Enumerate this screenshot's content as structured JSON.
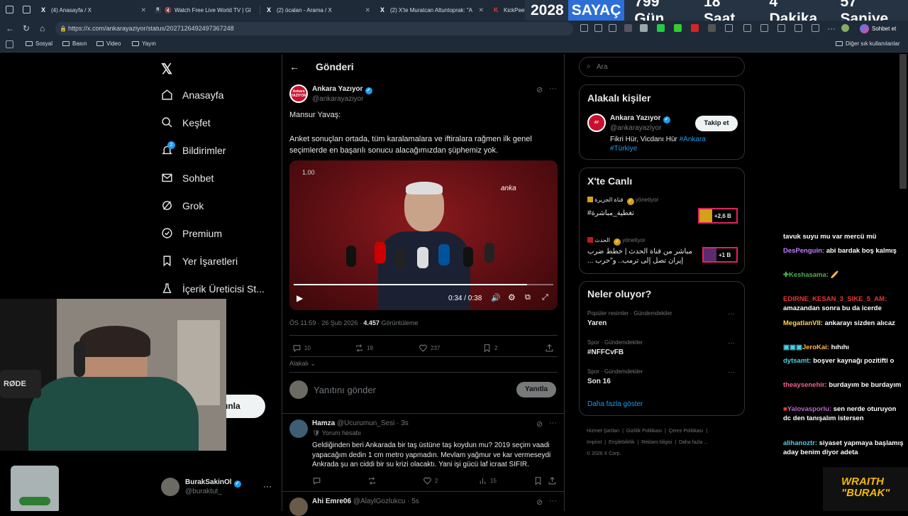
{
  "browser": {
    "tabs": [
      {
        "title": "(4) Anasayfa / X",
        "icon": "X"
      },
      {
        "title": "Watch Free Live World TV | Gl",
        "icon": "fl"
      },
      {
        "title": "(2) öcalan - Arama / X",
        "icon": "X"
      },
      {
        "title": "(2) X'te Muratcan Altuntoprak: \"A",
        "icon": "X"
      },
      {
        "title": "KickPeek",
        "icon": "K"
      }
    ],
    "url": "https://x.com/ankarayaziyor/status/2027126492497367248",
    "chat_button": "Sohbet et",
    "bookmarks": [
      "Sosyal",
      "Basın",
      "Video",
      "Yayın"
    ],
    "bookmarks_other": "Diğer sık kullanılanlar"
  },
  "counter": {
    "year": "2028",
    "label": "SAYAÇ",
    "days": "799 Gün",
    "hours": "18 Saat",
    "minutes": "4 Dakika",
    "seconds": "57 Saniye"
  },
  "nav": {
    "items": [
      "Anasayfa",
      "Keşfet",
      "Bildirimler",
      "Sohbet",
      "Grok",
      "Premium",
      "Yer İşaretleri",
      "İçerik Üreticisi St..."
    ],
    "notif_badge": "2",
    "post_button_fragment": "ınla",
    "account": {
      "name": "BurakSakinOl",
      "handle": "@buraktut_"
    }
  },
  "post": {
    "header": "Gönderi",
    "author": "Ankara Yazıyor",
    "handle": "@ankarayaziyor",
    "avatar_text": "Ankara YAZIYOR",
    "text1": "Mansur Yavaş:",
    "text2": "Anket sonuçları ortada, tüm karalamalara ve iftiralara rağmen ilk genel seçimlerde en başarılı sonucu alacağımızdan şüphemiz yok.",
    "video": {
      "speed": "1.00",
      "time": "0:34 / 0:38",
      "watermark": "anka",
      "progress": 0.9
    },
    "meta_time": "ÖS 11:59 · 26 Şub 2026 · ",
    "views": "4.457",
    "views_label": " Görüntüleme",
    "stats": {
      "replies": "10",
      "reposts": "19",
      "likes": "237",
      "bookmarks": "2"
    },
    "sort": "Alakalı",
    "reply_placeholder": "Yanıtını gönder",
    "reply_button": "Yanıtla"
  },
  "replies": [
    {
      "name": "Hamza",
      "handle": "@Ucurumun_Sesi · 3s",
      "sub": "Yorum hesabı",
      "text": "Geldiğinden beri Ankarada bir taş üstüne taş koydun mu? 2019 seçim vaadi yapacağım dedin 1 cm metro yapmadın.  Mevlam yağmur ve kar vermeseydi Ankrada şu an ciddi bir su krizi olacaktı. Yani işi gücü laf icraat SIFIR.",
      "replies": "",
      "reposts": "",
      "likes": "2",
      "views": "15"
    },
    {
      "name": "Ahi Emre06",
      "handle": "@AlaylGozlukcu · 5s"
    }
  ],
  "search": {
    "placeholder": "Ara"
  },
  "related": {
    "title": "Alakalı kişiler",
    "name": "Ankara Yazıyor",
    "handle": "@ankarayaziyor",
    "follow": "Takip et",
    "bio": "Fikri Hür, Vicdanı Hür ",
    "tag1": "#Ankara",
    "tag2": "#Türkiye"
  },
  "live": {
    "title": "X'te Canlı",
    "items": [
      {
        "source": "قناة الجزيرة",
        "status": "yönetiyor",
        "text": "#تغطية_مباشرة",
        "count": "+2,6 B"
      },
      {
        "source": "الحدث",
        "status": "yönetiyor",
        "text": "مباشر من قناة الحدث | خطط ضرب إيران تصل إلى ترمب.. و\"حرب ...",
        "count": "+1 B"
      }
    ]
  },
  "trends": {
    "title": "Neler oluyor?",
    "items": [
      {
        "context": "Popüler resimler · Gündemdekiler",
        "name": "Yaren"
      },
      {
        "context": "Spor · Gündemdekiler",
        "name": "#NFFCvFB"
      },
      {
        "context": "Spor · Gündemdekiler",
        "name": "Son 16"
      }
    ],
    "more": "Daha fazla göster"
  },
  "footer": {
    "links": [
      "Hizmet Şartları",
      "Gizlilik Politikası",
      "Çerez Politikası",
      "Imprint",
      "Erişilebilirlik",
      "Reklam bilgisi",
      "Daha fazla ..."
    ],
    "copyright": "© 2026 X Corp."
  },
  "chat": [
    {
      "user": "",
      "msg": "tavuk suyu mu var mercü mü",
      "color": "#ffffff"
    },
    {
      "user": "DesPenguin:",
      "msg": " abi bardak boş kalmış",
      "color": "#c77dff"
    },
    {
      "user": "Keshasama:",
      "msg": " 🥖",
      "color": "#4caf50"
    },
    {
      "user": "EDIRNE_KESAN_3_SIKE_5_AM:",
      "msg": " amazandan sonra bu da icerde",
      "color": "#e53935"
    },
    {
      "user": "MegatlanVII:",
      "msg": " ankarayı sizden alıcaz",
      "color": "#ffd54f"
    },
    {
      "user": "JeroKai:",
      "msg": " hıhıhı",
      "color": "#ffb74d"
    },
    {
      "user": "dytsamt:",
      "msg": " boşver kaynağı pozitifti o",
      "color": "#4dd0e1"
    },
    {
      "user": "theaysenehir:",
      "msg": " burdayım be burdayım",
      "color": "#f06292"
    },
    {
      "user": "Yalovasporlu:",
      "msg": " sen nerde oturuyon dc den tanışalım istersen",
      "color": "#ba68c8"
    },
    {
      "user": "alihanoztr:",
      "msg": " siyaset yapmaya başlamış aday benim diyor adeta",
      "color": "#4dd0e1"
    }
  ],
  "overlay": {
    "brand1": "WRAITH",
    "brand2": "\"BURAK\"",
    "mic": "RØDE"
  }
}
